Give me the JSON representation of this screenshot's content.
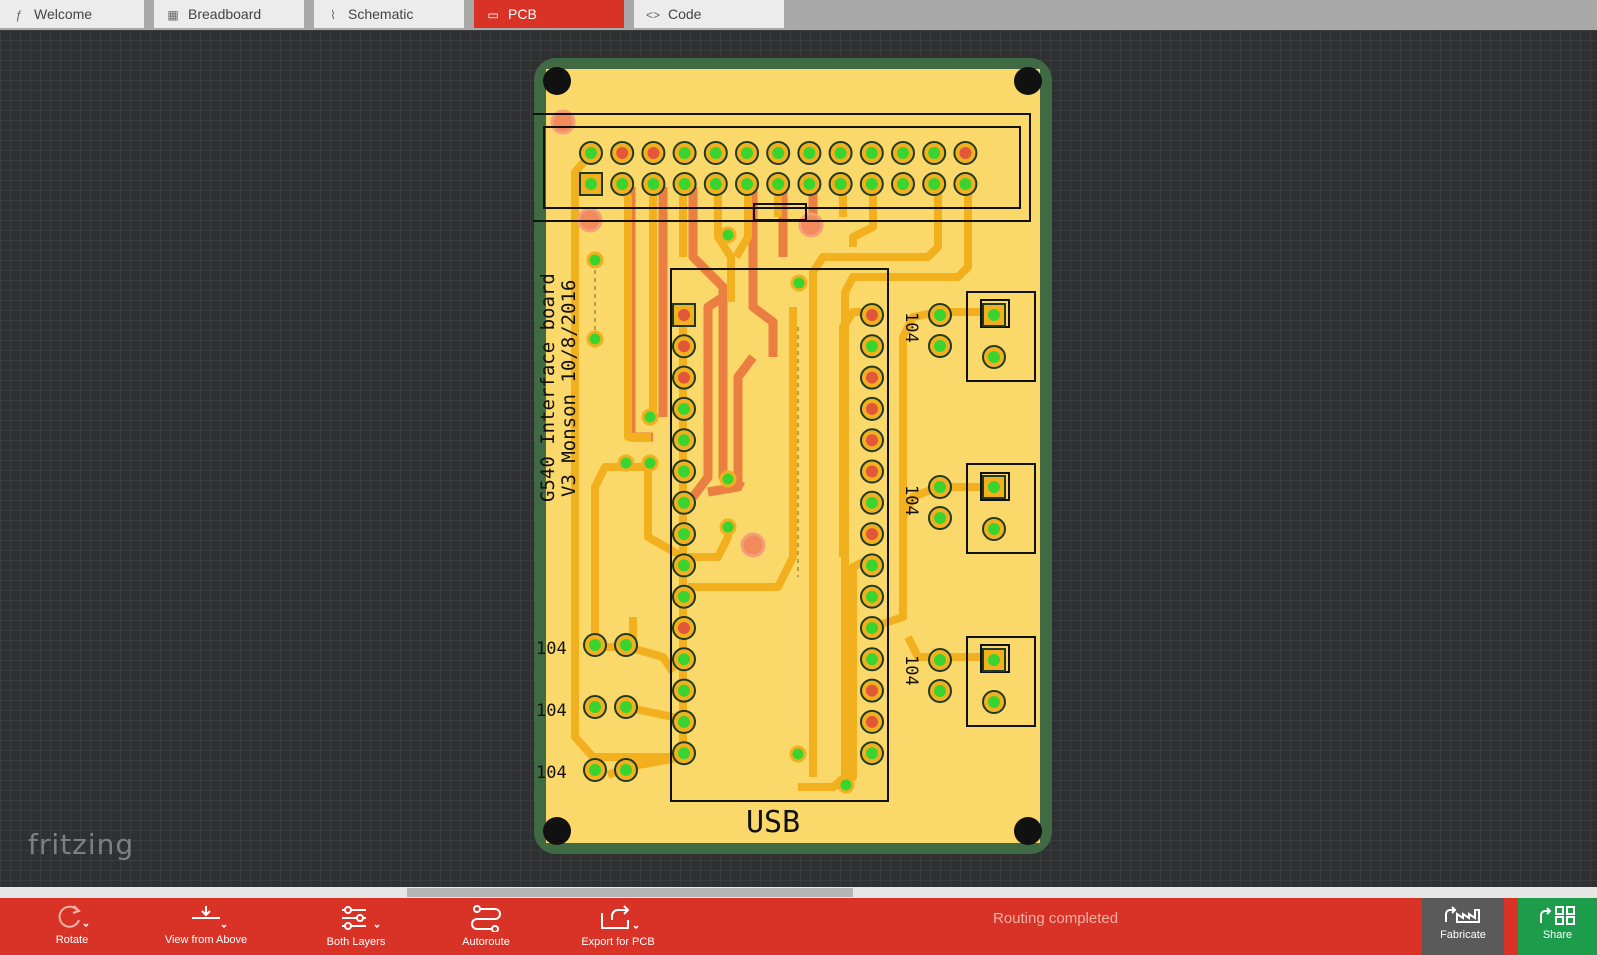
{
  "tabs": [
    {
      "label": "Welcome",
      "icon": "fritzing-icon"
    },
    {
      "label": "Breadboard",
      "icon": "breadboard-icon"
    },
    {
      "label": "Schematic",
      "icon": "schematic-icon"
    },
    {
      "label": "PCB",
      "icon": "pcb-icon",
      "active": true
    },
    {
      "label": "Code",
      "icon": "code-icon"
    }
  ],
  "board": {
    "silk_text_line1": "G540 Interface board",
    "silk_text_line2": "V3 Monson 10/8/2016",
    "usb_label": "USB",
    "cap_labels": [
      "104",
      "104",
      "104",
      "104",
      "104",
      "104"
    ]
  },
  "logo": "fritzing",
  "toolbar": {
    "rotate": "Rotate",
    "view_from_above": "View from Above",
    "both_layers": "Both Layers",
    "autoroute": "Autoroute",
    "export_for_pcb": "Export for PCB",
    "status": "Routing completed",
    "fabricate": "Fabricate",
    "share": "Share"
  },
  "colors": {
    "accent": "#d93226",
    "board_green": "#3f6a44",
    "copper_top": "#f2b01e",
    "copper_bottom": "#e8703a",
    "share_green": "#1d9c4b"
  }
}
